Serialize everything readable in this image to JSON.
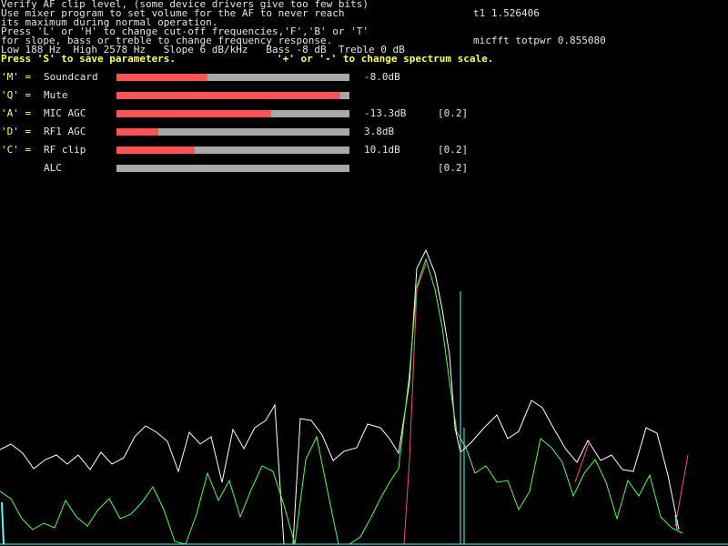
{
  "colors": {
    "background": "#000000",
    "text": "#e4e4e4",
    "highlight": "#ffff5a",
    "bar_track": "#a8a8a8",
    "bar_fill": "#fc5454",
    "trace_white": "#ffffff",
    "trace_green": "#54fc54",
    "trace_red": "#fc5454",
    "trace_cyan": "#54fcfc"
  },
  "info": {
    "line1": "Verify AF clip level, (some device drivers give too few bits)",
    "line2": "Use mixer program to set volume for the AF to never reach",
    "line3": "its maximum during normal operation.",
    "line4": "Press 'L' or 'H' to change cut-off frequencies,'F','B' or 'T'",
    "line5": "for slope, bass or treble to change frequency response.",
    "line6": "Low 188 Hz  High 2578 Hz   Slope 6 dB/kHz   Bass -8 dB  Treble 0 dB",
    "save_hint": "Press 'S' to save parameters.",
    "scale_hint": "'+' or '-' to change spectrum scale.",
    "t1": "t1 1.526406",
    "micfft": "micfft totpwr 0.855080"
  },
  "controls": [
    {
      "key": "'M' =",
      "label": "Soundcard",
      "level": 0.39,
      "value": "-8.0dB",
      "range": ""
    },
    {
      "key": "'Q' =",
      "label": "Mute",
      "level": 0.96,
      "value": "",
      "range": ""
    },
    {
      "key": "'A' =",
      "label": "MIC AGC",
      "level": 0.665,
      "value": "-13.3dB",
      "range": "[0.2]"
    },
    {
      "key": "'D' =",
      "label": "RF1 AGC",
      "level": 0.18,
      "value": "3.8dB",
      "range": ""
    },
    {
      "key": "'C' =",
      "label": "RF clip",
      "level": 0.335,
      "value": "10.1dB",
      "range": "[0.2]"
    },
    {
      "key": "",
      "label": "ALC",
      "level": 0.0,
      "value": "",
      "range": "[0.2]"
    }
  ]
}
